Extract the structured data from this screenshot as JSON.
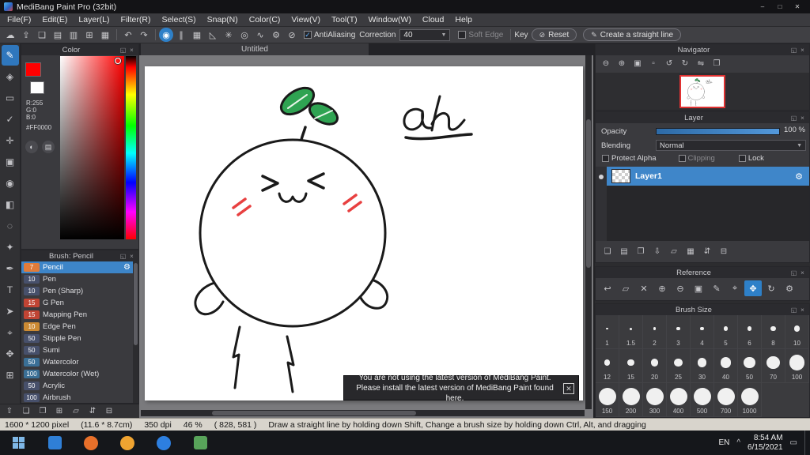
{
  "window": {
    "title": "MediBang Paint Pro (32bit)",
    "controls": [
      {
        "name": "minimize-button",
        "glyph": "–"
      },
      {
        "name": "maximize-button",
        "glyph": "□"
      },
      {
        "name": "close-button",
        "glyph": "✕"
      }
    ]
  },
  "menu": {
    "items": [
      "File(F)",
      "Edit(E)",
      "Layer(L)",
      "Filter(R)",
      "Select(S)",
      "Snap(N)",
      "Color(C)",
      "View(V)",
      "Tool(T)",
      "Window(W)",
      "Cloud",
      "Help"
    ]
  },
  "panel_header_icons": [
    {
      "name": "popout-panel-icon",
      "glyph": "◱"
    },
    {
      "name": "close-panel-icon",
      "glyph": "×"
    }
  ],
  "toolbar": {
    "file_icons": [
      {
        "name": "cloud-icon",
        "glyph": "☁"
      },
      {
        "name": "export-icon",
        "glyph": "⇪"
      },
      {
        "name": "chat-icon",
        "glyph": "❏"
      },
      {
        "name": "note-icon",
        "glyph": "▤"
      },
      {
        "name": "document-icon",
        "glyph": "▥"
      },
      {
        "name": "grid-icon",
        "glyph": "⊞"
      },
      {
        "name": "panel-layout-icon",
        "glyph": "▦"
      }
    ],
    "history_icons": [
      {
        "name": "undo-icon",
        "glyph": "↶"
      },
      {
        "name": "redo-icon",
        "glyph": "↷"
      }
    ],
    "snap_icons": [
      {
        "name": "brush-cursor-icon",
        "glyph": "◉",
        "active": true
      },
      {
        "name": "snap-parallel-icon",
        "glyph": "∥"
      },
      {
        "name": "snap-grid-icon",
        "glyph": "▦"
      },
      {
        "name": "snap-perspective-icon",
        "glyph": "◺"
      },
      {
        "name": "snap-radial-icon",
        "glyph": "✳"
      },
      {
        "name": "snap-ellipse-icon",
        "glyph": "◎"
      },
      {
        "name": "snap-curve-icon",
        "glyph": "∿"
      },
      {
        "name": "snap-settings-icon",
        "glyph": "⚙"
      },
      {
        "name": "snap-off-icon",
        "glyph": "⊘"
      }
    ],
    "antialiasing_label": "AntiAliasing",
    "correction_label": "Correction",
    "correction_value": "40",
    "soft_edge_label": "Soft Edge",
    "key_label": "Key",
    "reset_label": "Reset",
    "reset_icon_glyph": "⊘",
    "straight_line_label": "Create a straight line",
    "straight_line_icon_glyph": "✎"
  },
  "tools": {
    "items": [
      {
        "name": "brush-tool",
        "glyph": "✎",
        "active": true
      },
      {
        "name": "eraser-tool",
        "glyph": "◈"
      },
      {
        "name": "select-rect-tool",
        "glyph": "▭"
      },
      {
        "name": "select-pen-tool",
        "glyph": "✓"
      },
      {
        "name": "move-tool",
        "glyph": "✛"
      },
      {
        "name": "fill-tool",
        "glyph": "▣"
      },
      {
        "name": "bucket-tool",
        "glyph": "◉"
      },
      {
        "name": "gradient-tool",
        "glyph": "◧"
      },
      {
        "name": "lasso-tool",
        "glyph": "◌"
      },
      {
        "name": "magic-wand-tool",
        "glyph": "✦"
      },
      {
        "name": "pen-tool",
        "glyph": "✒"
      },
      {
        "name": "text-tool",
        "glyph": "T"
      },
      {
        "name": "operation-tool",
        "glyph": "➤"
      },
      {
        "name": "eyedropper-tool",
        "glyph": "⌖"
      },
      {
        "name": "hand-tool",
        "glyph": "✥"
      },
      {
        "name": "divide-tool",
        "glyph": "⊞"
      }
    ]
  },
  "color_panel": {
    "title": "Color",
    "r_label": "R:255",
    "g_label": "G:0",
    "b_label": "B:0",
    "hex_label": "#FF0000",
    "foreground_color": "#ff0000",
    "icons": [
      {
        "name": "color-wheel-icon",
        "glyph": "◐"
      },
      {
        "name": "color-set-icon",
        "glyph": "▤"
      }
    ]
  },
  "brush_panel": {
    "title": "Brush: Pencil",
    "brushes": [
      {
        "size": "7",
        "name": "Pencil",
        "chip": "#e07b39",
        "selected": true
      },
      {
        "size": "10",
        "name": "Pen",
        "chip": "#47506b"
      },
      {
        "size": "10",
        "name": "Pen (Sharp)",
        "chip": "#47506b"
      },
      {
        "size": "15",
        "name": "G Pen",
        "chip": "#c04434"
      },
      {
        "size": "15",
        "name": "Mapping Pen",
        "chip": "#c04434"
      },
      {
        "size": "10",
        "name": "Edge Pen",
        "chip": "#cc8a33"
      },
      {
        "size": "50",
        "name": "Stipple Pen",
        "chip": "#47506b"
      },
      {
        "size": "50",
        "name": "Sumi",
        "chip": "#47506b"
      },
      {
        "size": "50",
        "name": "Watercolor",
        "chip": "#3a6f96"
      },
      {
        "size": "100",
        "name": "Watercolor (Wet)",
        "chip": "#3a6f96"
      },
      {
        "size": "50",
        "name": "Acrylic",
        "chip": "#47506b"
      },
      {
        "size": "100",
        "name": "Airbrush",
        "chip": "#47506b"
      }
    ]
  },
  "left_footer_icons": [
    {
      "name": "up-icon",
      "glyph": "⇧"
    },
    {
      "name": "new-brush-icon",
      "glyph": "❏"
    },
    {
      "name": "duplicate-brush-icon",
      "glyph": "❐"
    },
    {
      "name": "add-folder-icon",
      "glyph": "⊞"
    },
    {
      "name": "folder-icon",
      "glyph": "▱"
    },
    {
      "name": "sync-icon",
      "glyph": "⇵"
    },
    {
      "name": "trash-icon",
      "glyph": "⊟"
    }
  ],
  "canvas": {
    "tab_title": "Untitled",
    "annotation": "ah",
    "notification": {
      "line1": "You are not using the latest version of MediBang Paint.",
      "line2": "Please install the latest version of MediBang Paint found here.",
      "close_glyph": "✕"
    }
  },
  "navigator": {
    "title": "Navigator",
    "icons": [
      {
        "name": "zoom-out-icon",
        "glyph": "⊖"
      },
      {
        "name": "zoom-in-icon",
        "glyph": "⊕"
      },
      {
        "name": "zoom-fit-icon",
        "glyph": "▣"
      },
      {
        "name": "zoom-actual-icon",
        "glyph": "▫"
      },
      {
        "name": "rotate-left-icon",
        "glyph": "↺"
      },
      {
        "name": "rotate-right-icon",
        "glyph": "↻"
      },
      {
        "name": "flip-icon",
        "glyph": "⇋"
      },
      {
        "name": "fullscreen-icon",
        "glyph": "❐"
      }
    ]
  },
  "layer_panel": {
    "title": "Layer",
    "opacity_label": "Opacity",
    "opacity_value": "100 %",
    "blending_label": "Blending",
    "blending_value": "Normal",
    "checkboxes": [
      {
        "name": "protect-alpha-checkbox",
        "label": "Protect Alpha",
        "checked": false
      },
      {
        "name": "clipping-checkbox",
        "label": "Clipping",
        "checked": false,
        "dimmed": true
      },
      {
        "name": "lock-checkbox",
        "label": "Lock",
        "checked": false
      }
    ],
    "layers": [
      {
        "name": "Layer1",
        "selected": true
      }
    ],
    "footer_icons": [
      {
        "name": "new-layer-icon",
        "glyph": "❏"
      },
      {
        "name": "new-folder-icon",
        "glyph": "▤"
      },
      {
        "name": "duplicate-layer-icon",
        "glyph": "❐"
      },
      {
        "name": "merge-down-icon",
        "glyph": "⇩"
      },
      {
        "name": "layer-folder-icon",
        "glyph": "▱"
      },
      {
        "name": "combine-icon",
        "glyph": "▦"
      },
      {
        "name": "reorder-icon",
        "glyph": "⇵"
      },
      {
        "name": "delete-layer-icon",
        "glyph": "⊟"
      }
    ]
  },
  "reference_panel": {
    "title": "Reference",
    "icons": [
      {
        "name": "back-icon",
        "glyph": "↩"
      },
      {
        "name": "open-folder-icon",
        "glyph": "▱"
      },
      {
        "name": "close-image-icon",
        "glyph": "✕"
      },
      {
        "name": "zoom-in-icon",
        "glyph": "⊕"
      },
      {
        "name": "zoom-out-icon",
        "glyph": "⊖"
      },
      {
        "name": "fit-icon",
        "glyph": "▣"
      },
      {
        "name": "pen-pick-icon",
        "glyph": "✎"
      },
      {
        "name": "eyedropper-icon",
        "glyph": "⌖"
      },
      {
        "name": "hand-icon",
        "glyph": "✥",
        "active": true
      },
      {
        "name": "rotate-icon",
        "glyph": "↻"
      },
      {
        "name": "settings-icon",
        "glyph": "⚙"
      }
    ]
  },
  "brush_size_panel": {
    "title": "Brush Size",
    "sizes": [
      "1",
      "1.5",
      "2",
      "3",
      "4",
      "5",
      "6",
      "8",
      "10",
      "12",
      "15",
      "20",
      "25",
      "30",
      "40",
      "50",
      "70",
      "100",
      "150",
      "200",
      "300",
      "400",
      "500",
      "700",
      "1000"
    ]
  },
  "status_bar": {
    "segments": [
      "1600 * 1200 pixel",
      "(11.6 * 8.7cm)",
      "350 dpi",
      "46 %",
      "( 828, 581 )",
      "Draw a straight line by holding down Shift, Change a brush size by holding down Ctrl, Alt, and dragging"
    ]
  },
  "taskbar": {
    "icons": [
      {
        "name": "start-button",
        "type": "windows",
        "color": "#7fb8e8"
      },
      {
        "name": "mail-app-icon",
        "type": "square",
        "color": "#2f7fd6"
      },
      {
        "name": "firefox-app-icon",
        "type": "circle",
        "color": "#e8702a"
      },
      {
        "name": "chrome-app-icon",
        "type": "circle",
        "color": "#f0a431"
      },
      {
        "name": "edge-app-icon",
        "type": "circle",
        "color": "#2d7fe0"
      },
      {
        "name": "medibang-app-icon",
        "type": "square",
        "color": "#58a35a"
      }
    ],
    "tray_caret": "^",
    "language": "EN",
    "time": "8:54 AM",
    "date": "6/15/2021",
    "tray_icon_glyph": "▭"
  }
}
